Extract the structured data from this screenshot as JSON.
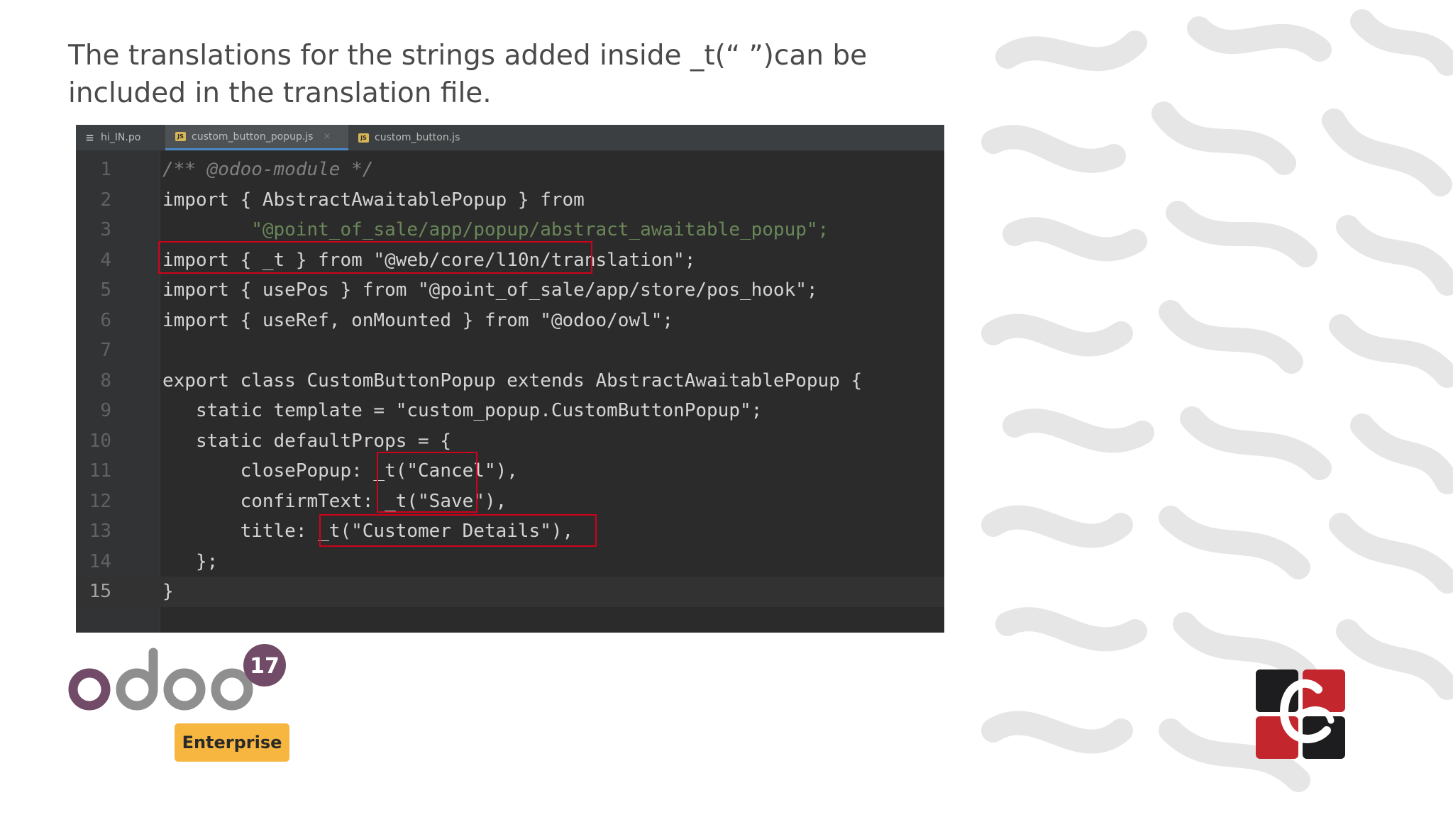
{
  "slide": {
    "heading": "The translations for the strings added inside _t(“ ”)can be included in the translation file."
  },
  "editor": {
    "tabs": [
      {
        "label": "hi_IN.po",
        "icon": "po-file-icon",
        "active": false
      },
      {
        "label": "custom_button_popup.js",
        "icon": "js-file-icon",
        "active": true
      },
      {
        "label": "custom_button.js",
        "icon": "js-file-icon",
        "active": false
      }
    ],
    "js_badge": "JS",
    "close_glyph": "×",
    "lines": [
      {
        "n": "1",
        "text": "/** @odoo-module */"
      },
      {
        "n": "2",
        "text": "import { AbstractAwaitablePopup } from"
      },
      {
        "n": "3",
        "text": "        \"@point_of_sale/app/popup/abstract_awaitable_popup\";"
      },
      {
        "n": "4",
        "text": "import { _t } from \"@web/core/l10n/translation\";"
      },
      {
        "n": "5",
        "text": "import { usePos } from \"@point_of_sale/app/store/pos_hook\";"
      },
      {
        "n": "6",
        "text": "import { useRef, onMounted } from \"@odoo/owl\";"
      },
      {
        "n": "7",
        "text": ""
      },
      {
        "n": "8",
        "text": "export class CustomButtonPopup extends AbstractAwaitablePopup {"
      },
      {
        "n": "9",
        "text": "   static template = \"custom_popup.CustomButtonPopup\";"
      },
      {
        "n": "10",
        "text": "   static defaultProps = {"
      },
      {
        "n": "11",
        "text": "       closePopup: _t(\"Cancel\"),"
      },
      {
        "n": "12",
        "text": "       confirmText: _t(\"Save\"),"
      },
      {
        "n": "13",
        "text": "       title: _t(\"Customer Details\"),"
      },
      {
        "n": "14",
        "text": "   };"
      },
      {
        "n": "15",
        "text": "}"
      }
    ],
    "current_line": "15"
  },
  "branding": {
    "logo_text": "odoo",
    "version_badge": "17",
    "edition_badge": "Enterprise",
    "colors": {
      "odoo_purple": "#714b67",
      "odoo_grey": "#8f8f8f",
      "badge_yellow": "#f6b640",
      "brand_red": "#c4262e",
      "brand_black": "#1d1d1f",
      "highlight_red": "#d0021b"
    }
  }
}
